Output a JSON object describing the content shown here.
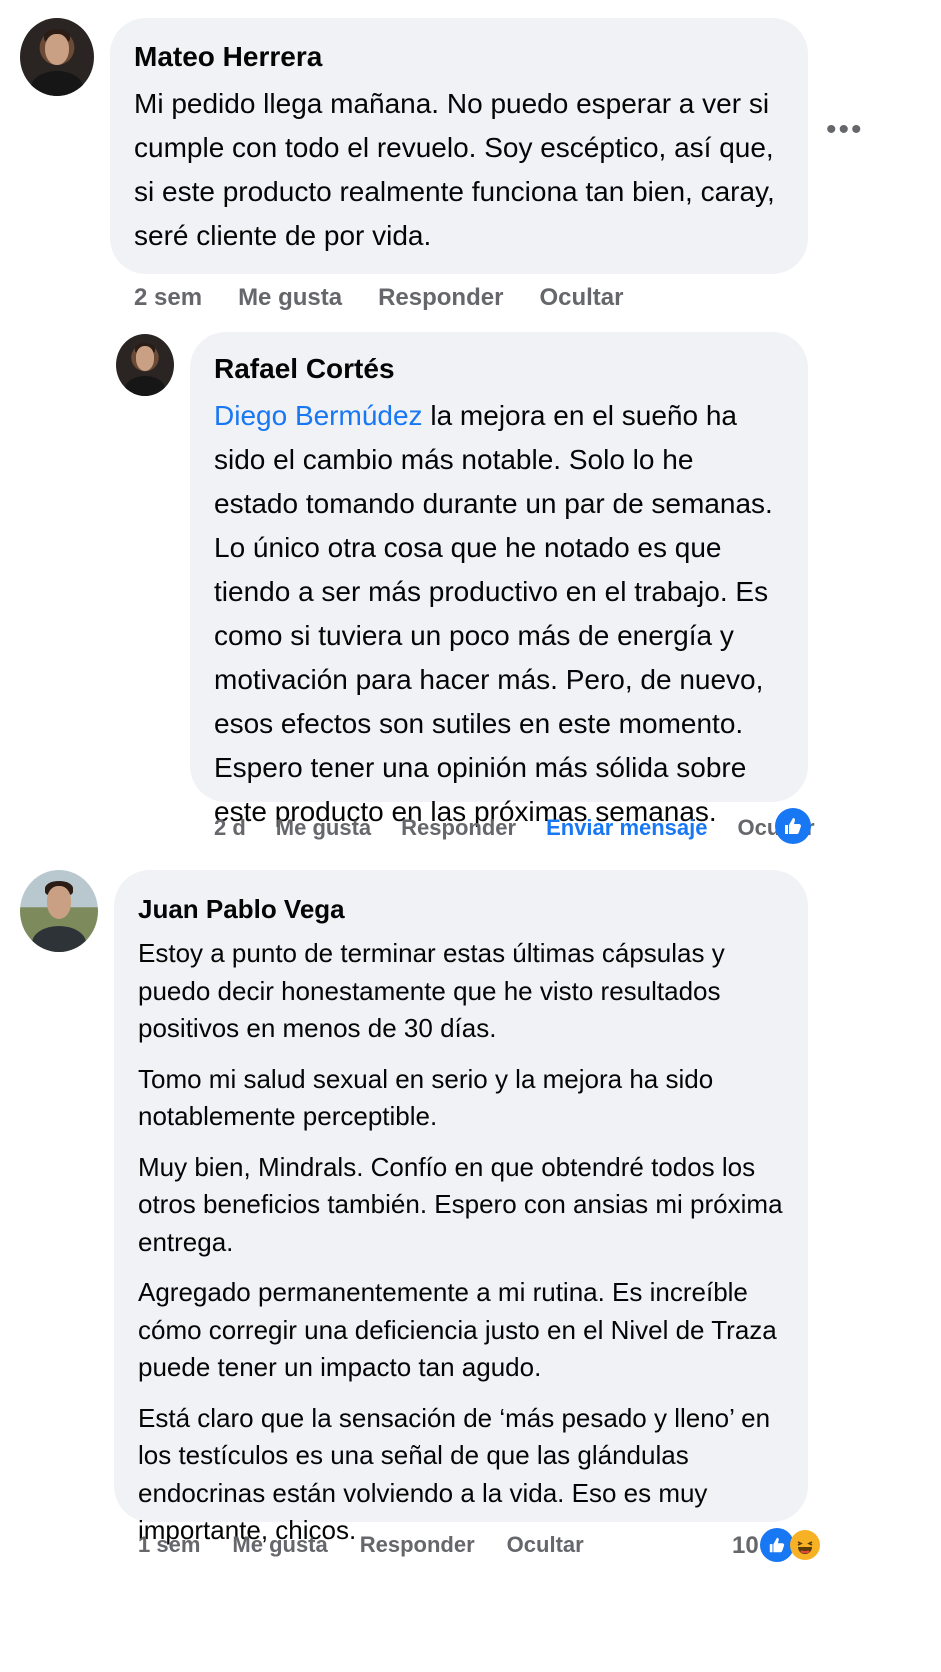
{
  "comments": [
    {
      "author": "Mateo Herrera",
      "text": "Mi pedido llega mañana. No puedo esperar a ver si cumple con todo el revuelo. Soy escéptico, así que, si este producto realmente funciona tan bien, caray, seré cliente de por vida.",
      "time": "2 sem",
      "like_label": "Me gusta",
      "reply_label": "Responder",
      "hide_label": "Ocultar"
    },
    {
      "author": "Rafael Cortés",
      "mention": "Diego Bermúdez",
      "text": "la mejora en el sueño ha sido el cambio más notable. Solo lo he estado tomando durante un par de semanas. Lo único otra cosa que he notado es que tiendo a ser más productivo en el trabajo. Es como si tuviera un poco más de energía y motivación para hacer más. Pero, de nuevo, esos efectos son sutiles en este momento. Espero tener una opinión más sólida sobre este producto en las próximas semanas.",
      "time": "2 d",
      "like_label": "Me gusta",
      "reply_label": "Responder",
      "message_label": "Enviar mensaje",
      "hide_label": "Ocultar"
    },
    {
      "author": "Juan Pablo Vega",
      "paragraphs": [
        "Estoy a punto de terminar estas últimas cápsulas y puedo decir honestamente que he visto resultados positivos en menos de 30 días.",
        "Tomo mi salud sexual en serio y la mejora ha sido notablemente perceptible.",
        "Muy bien, Mindrals. Confío en que obtendré todos los otros beneficios también. Espero con ansias mi próxima entrega.",
        "Agregado permanentemente a mi rutina. Es increíble cómo corregir una deficiencia justo en el Nivel de Traza puede tener un impacto tan agudo.",
        "Está claro que la sensación de ‘más pesado y lleno’ en los testículos es una señal de que las glándulas endocrinas están volviendo a la vida. Eso es muy importante, chicos."
      ],
      "time": "1 sem",
      "like_label": "Me gusta",
      "reply_label": "Responder",
      "hide_label": "Ocultar",
      "reaction_count": "10"
    }
  ],
  "icons": {
    "more": "more-horizontal-icon",
    "like": "thumbs-up-icon",
    "haha": "laughing-face-icon"
  },
  "colors": {
    "bubble": "#f0f2f5",
    "link": "#1877f2",
    "meta": "#65676b"
  }
}
